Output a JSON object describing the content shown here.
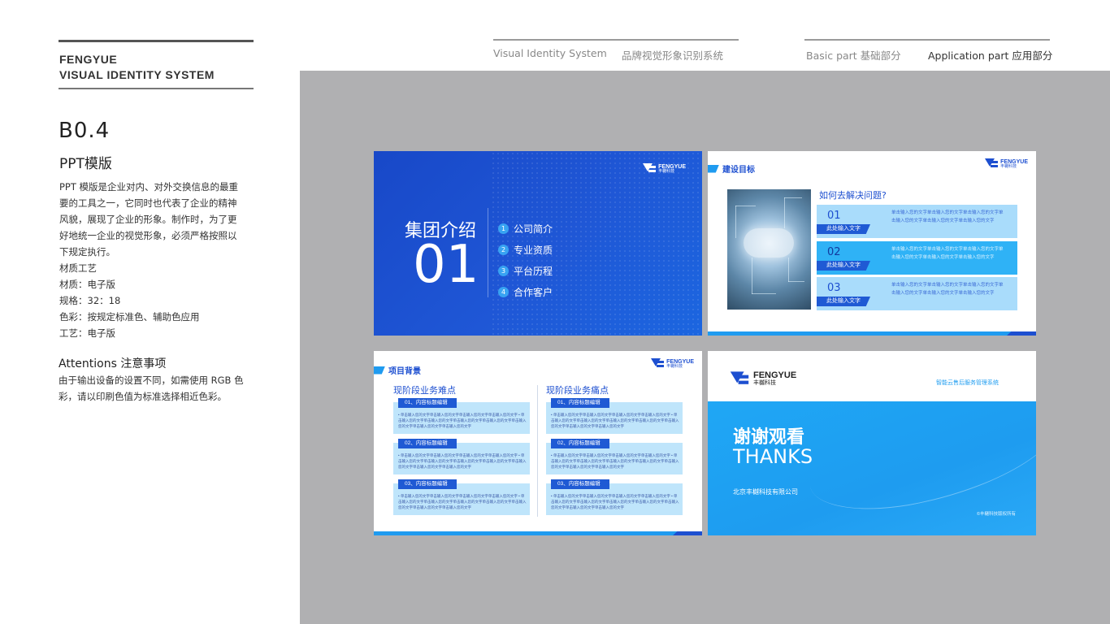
{
  "brand": {
    "line1": "FENGYUE",
    "line2": "VISUAL IDENTITY SYSTEM"
  },
  "section": {
    "code": "B0.4",
    "title": "PPT模版",
    "description_lines": [
      "PPT 模版是企业对内、对外交换信息的最重",
      "要的工具之一，它同时也代表了企业的精神",
      "风貌，展现了企业的形象。制作时，为了更",
      "好地统一企业的视觉形象，必须严格按照以",
      "下规定执行。"
    ],
    "specs": [
      "材质工艺",
      "材质：电子版",
      "规格：32：18",
      "色彩：按规定标准色、辅助色应用",
      "工艺：电子版"
    ],
    "attention_title": "Attentions 注意事项",
    "attention_lines": [
      "由于输出设备的设置不同，如需使用 RGB 色",
      "彩，请以印刷色值为标准选择相近色彩。"
    ]
  },
  "nav": {
    "vis_en": "Visual Identity System",
    "vis_cn": "品牌视觉形象识别系统",
    "basic": "Basic part  基础部分",
    "application": "Application part  应用部分"
  },
  "colors": {
    "primary_blue": "#1d4fd0",
    "sky_blue": "#1f9bf0",
    "canvas_gray": "#b0b0b2"
  },
  "logo": {
    "en": "FENGYUE",
    "cn": "丰樾科技"
  },
  "slide1": {
    "title": "集团介绍",
    "number": "01",
    "items": [
      {
        "n": "1",
        "label": "公司简介"
      },
      {
        "n": "2",
        "label": "专业资质"
      },
      {
        "n": "3",
        "label": "平台历程"
      },
      {
        "n": "4",
        "label": "合作客户"
      }
    ]
  },
  "slide2": {
    "heading": "建设目标",
    "question": "如何去解决问题?",
    "rows": [
      {
        "num": "01",
        "tag": "此处输入文字",
        "text": "单击输入您的文字单击输入您的文字单击输入您的文字单击输入您的文字单击输入您的文字单击输入您的文字"
      },
      {
        "num": "02",
        "tag": "此处输入文字",
        "text": "单击输入您的文字单击输入您的文字单击输入您的文字单击输入您的文字单击输入您的文字单击输入您的文字"
      },
      {
        "num": "03",
        "tag": "此处输入文字",
        "text": "单击输入您的文字单击输入您的文字单击输入您的文字单击输入您的文字单击输入您的文字单击输入您的文字"
      }
    ]
  },
  "slide3": {
    "heading": "项目背景",
    "left_title": "现阶段业务难点",
    "right_title": "现阶段业务痛点",
    "cards": [
      {
        "label": "01、内容标题编辑"
      },
      {
        "label": "02、内容标题编辑"
      },
      {
        "label": "03、内容标题编辑"
      }
    ],
    "card_body": "• 单击输入您的文字单击输入您的文字单击输入您的文字单击输入您的文字 • 单击输入您的文字单击输入您的文字单击输入您的文字单击输入您的文字单击输入您的文字单击输入您的文字单击输入您的文字"
  },
  "slide4": {
    "subtitle": "智能云售后服务管理系统",
    "thanks_cn": "谢谢观看",
    "thanks_en": "THANKS",
    "company": "北京丰樾科技有限公司",
    "copyright": "©丰樾科技版权所有"
  }
}
